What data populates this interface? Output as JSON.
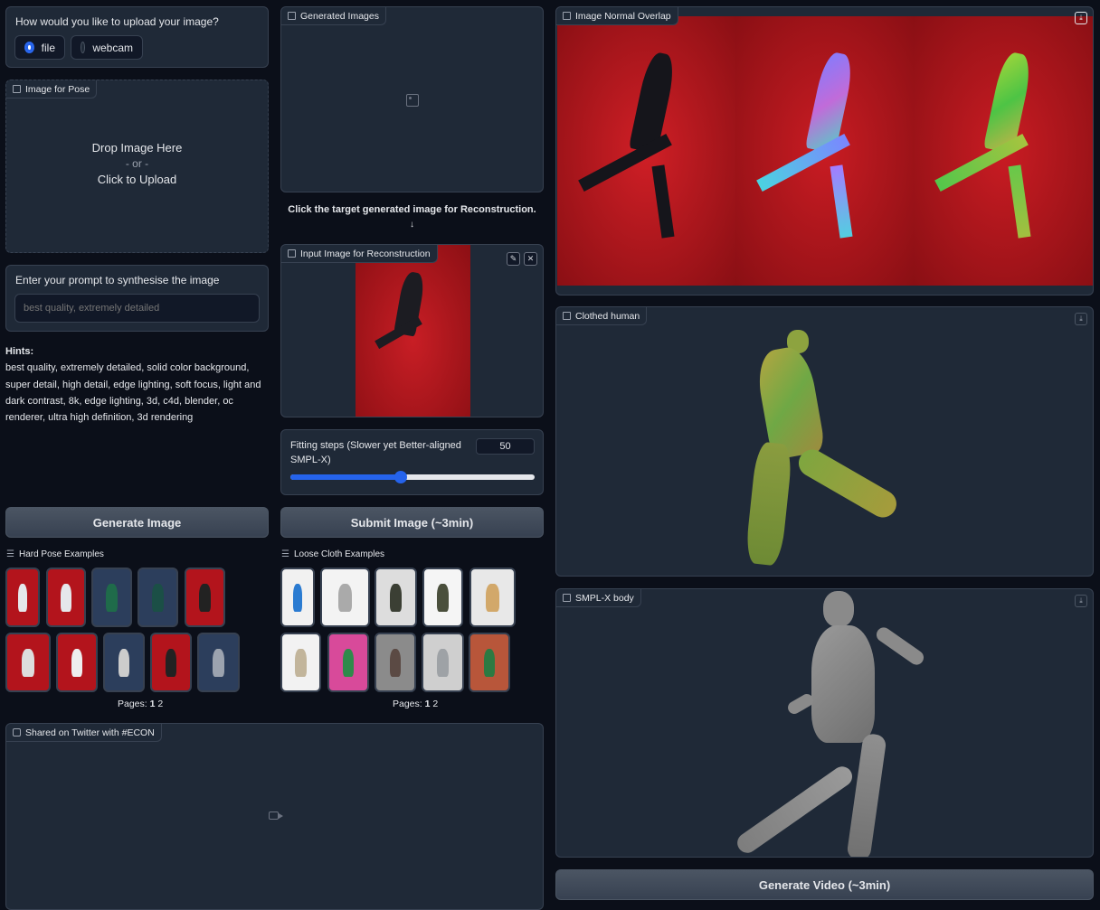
{
  "upload": {
    "question": "How would you like to upload your image?",
    "options": [
      "file",
      "webcam"
    ],
    "selected": "file"
  },
  "pose_image": {
    "tag": "Image for Pose",
    "drop_text": "Drop Image Here",
    "or_text": "- or -",
    "click_text": "Click to Upload"
  },
  "prompt": {
    "label": "Enter your prompt to synthesise the image",
    "placeholder": "best quality, extremely detailed",
    "value": ""
  },
  "hints": {
    "title": "Hints:",
    "text": "best quality, extremely detailed, solid color background, super detail, high detail, edge lighting, soft focus, light and dark contrast, 8k, edge lighting, 3d, c4d, blender, oc renderer, ultra high definition, 3d rendering"
  },
  "generated": {
    "tag": "Generated Images",
    "note": "Click the target generated image for Reconstruction.",
    "arrow": "↓"
  },
  "input_recon": {
    "tag": "Input Image for Reconstruction"
  },
  "fitting": {
    "label": "Fitting steps (Slower yet Better-aligned SMPL-X)",
    "value": "50",
    "fraction": 0.45
  },
  "buttons": {
    "generate_image": "Generate Image",
    "submit_image": "Submit Image (~3min)",
    "generate_video": "Generate Video (~3min)"
  },
  "examples": {
    "hard_pose_title": "Hard Pose Examples",
    "loose_cloth_title": "Loose Cloth Examples",
    "pages_label": "Pages:",
    "pages": [
      "1",
      "2"
    ]
  },
  "twitter": {
    "tag": "Shared on Twitter with #ECON"
  },
  "normal_overlap": {
    "tag": "Image Normal Overlap"
  },
  "clothed": {
    "tag": "Clothed human"
  },
  "smplx": {
    "tag": "SMPL-X body"
  },
  "colors": {
    "background": "#0b0f19",
    "panel": "#1f2937",
    "accent": "#2563eb",
    "photo_red": "#b3141c"
  }
}
